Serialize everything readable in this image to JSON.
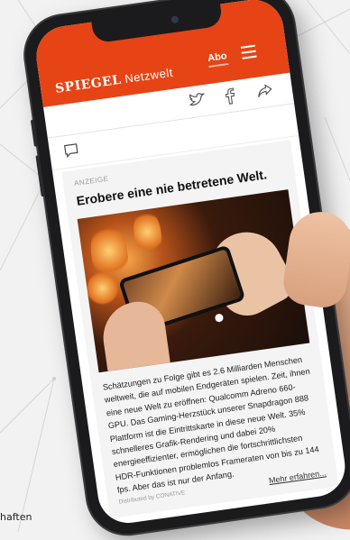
{
  "caption_fragment": "haften",
  "header": {
    "logo": "SPIEGEL",
    "section": "Netzwelt",
    "abo_label": "Abo",
    "background_color": "#e64415"
  },
  "toolbar": {
    "icons": [
      "twitter-icon",
      "facebook-icon",
      "share-icon"
    ]
  },
  "comment_icon": "comment-icon",
  "ad": {
    "label": "ANZEIGE",
    "title": "Erobere eine nie betretene Welt.",
    "body": "Schätzungen zu Folge gibt es 2.6 Milliarden Menschen weltweit, die auf mobilen Endgeräten spielen. Zeit, ihnen eine neue Welt zu eröffnen: Qualcomm Adreno 660-GPU. Das Gaming-Herzstück unserer Snapdragon 888 Plattform ist die Eintrittskarte in diese neue Welt. 35% schnelleres Grafik-Rendering und dabei 20% energieeffizienter, ermöglichen die fortschrittlichsten HDR-Funktionen problemlos Frameraten von bis zu 144 fps. Aber das ist nur der Anfang.",
    "distributed_by": "Distributed by CONATIVE",
    "more_link": "Mehr erfahren..."
  }
}
